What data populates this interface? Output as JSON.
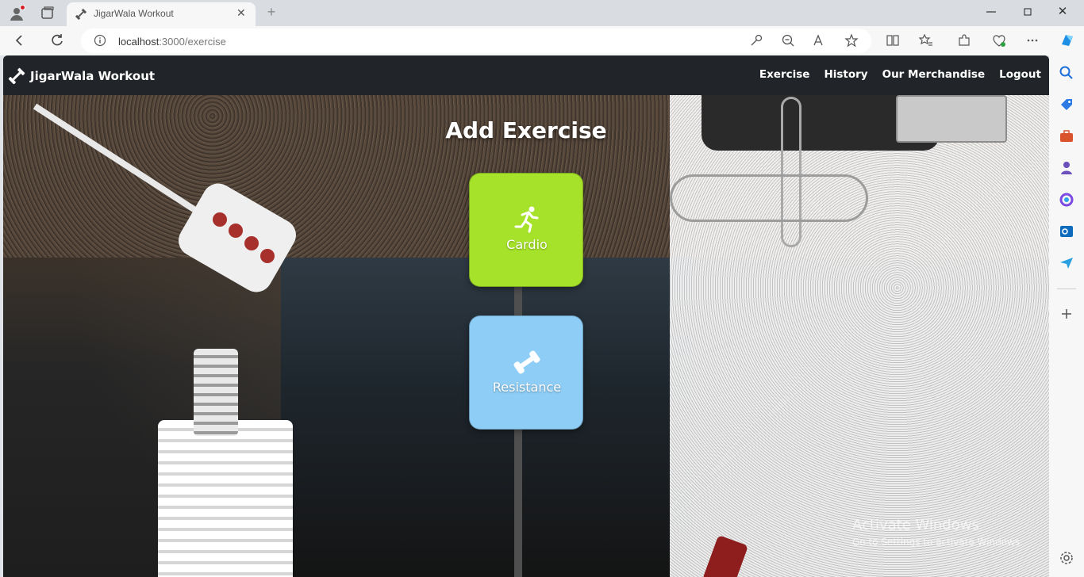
{
  "browser": {
    "tab_title": "JigarWala Workout",
    "url_host": "localhost",
    "url_rest": ":3000/exercise",
    "tab_close_glyph": "✕",
    "new_tab_glyph": "+",
    "win_close_glyph": "✕"
  },
  "app": {
    "brand": "JigarWala Workout",
    "nav": {
      "exercise": "Exercise",
      "history": "History",
      "merch": "Our Merchandise",
      "logout": "Logout"
    },
    "title": "Add Exercise",
    "cards": {
      "cardio": {
        "label": "Cardio",
        "color": "#a6e22a",
        "icon": "running-icon"
      },
      "resistance": {
        "label": "Resistance",
        "color": "#8ecdf5",
        "icon": "dumbbell-icon"
      }
    }
  },
  "watermark": {
    "line1": "Activate Windows",
    "line2": "Go to Settings to activate Windows."
  },
  "colors": {
    "navbar": "#212529",
    "accent_cardio": "#a6e22a",
    "accent_resistance": "#8ecdf5"
  }
}
